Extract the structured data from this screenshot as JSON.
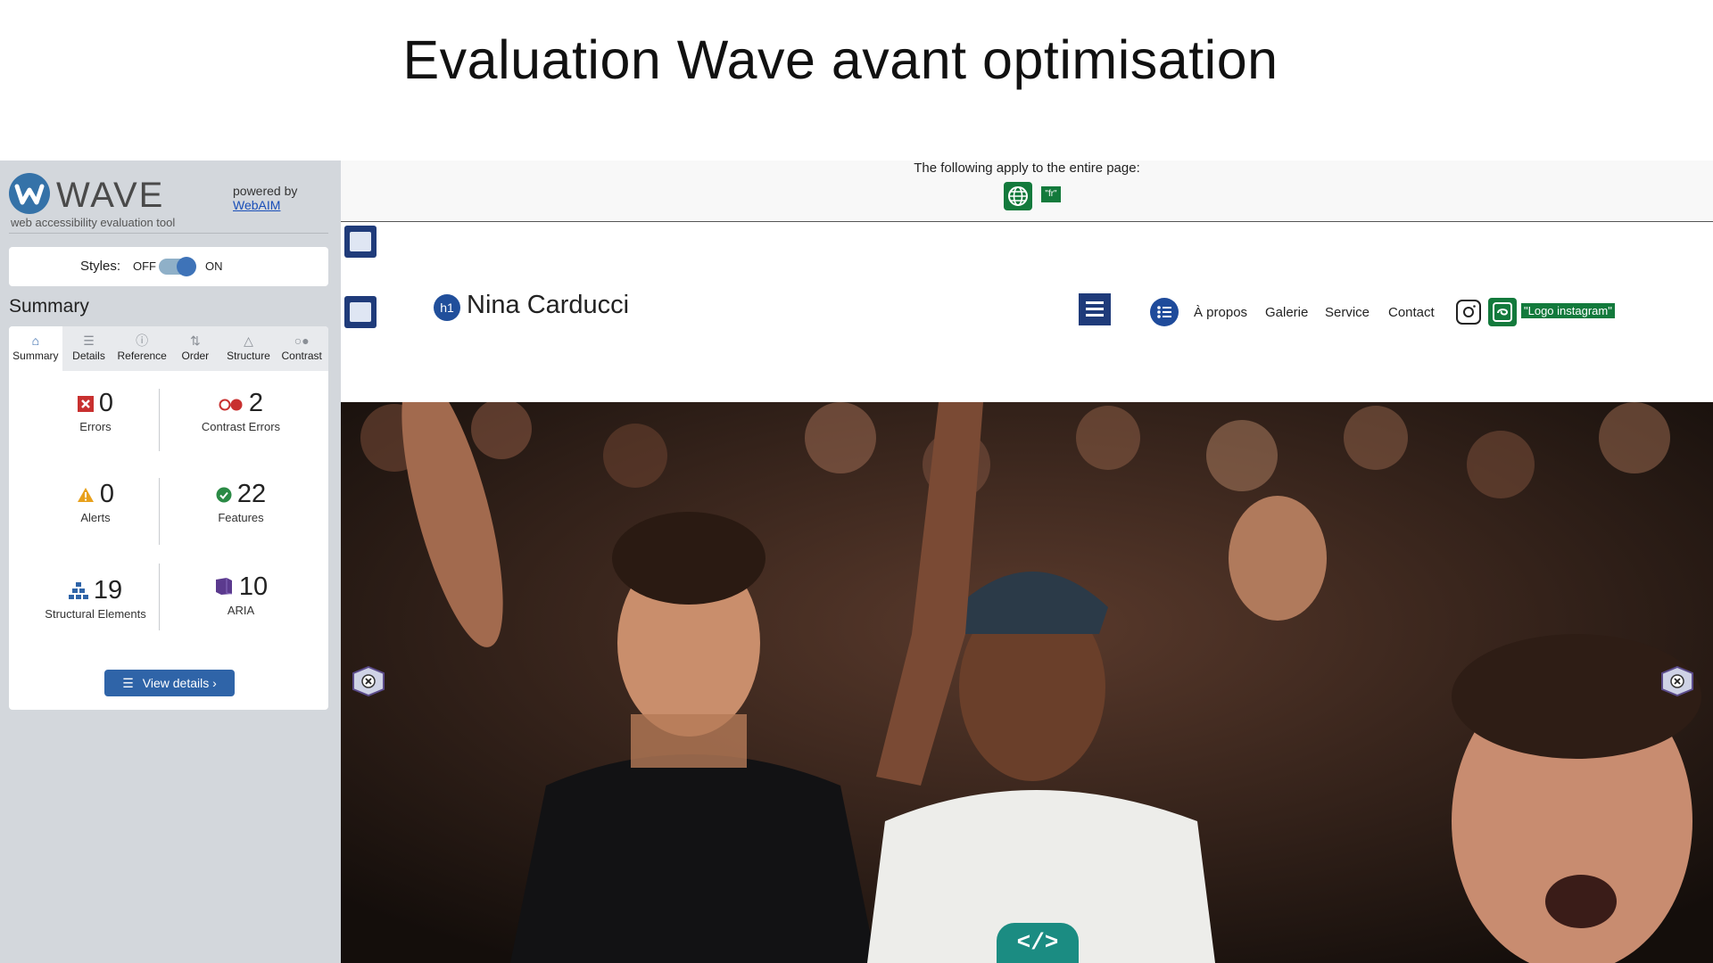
{
  "slide": {
    "title": "Evaluation Wave avant optimisation"
  },
  "wave": {
    "logo_text": "WAVE",
    "subtitle": "web accessibility evaluation tool",
    "powered_by": "powered by",
    "powered_link": "WebAIM",
    "styles": {
      "label": "Styles:",
      "off": "OFF",
      "on": "ON",
      "enabled": true
    },
    "summary_title": "Summary",
    "tabs": [
      {
        "label": "Summary",
        "icon": "home-icon",
        "active": true
      },
      {
        "label": "Details",
        "icon": "list-icon"
      },
      {
        "label": "Reference",
        "icon": "info-icon"
      },
      {
        "label": "Order",
        "icon": "order-icon"
      },
      {
        "label": "Structure",
        "icon": "structure-icon"
      },
      {
        "label": "Contrast",
        "icon": "contrast-icon"
      }
    ],
    "stats": {
      "errors": {
        "value": "0",
        "label": "Errors",
        "color": "#c8302f"
      },
      "contrast": {
        "value": "2",
        "label": "Contrast Errors",
        "color": "#c8302f"
      },
      "alerts": {
        "value": "0",
        "label": "Alerts",
        "color": "#e8a11c"
      },
      "features": {
        "value": "22",
        "label": "Features",
        "color": "#2a8a45"
      },
      "structural": {
        "value": "19",
        "label": "Structural Elements",
        "color": "#2f64a8"
      },
      "aria": {
        "value": "10",
        "label": "ARIA",
        "color": "#5b3a8e"
      }
    },
    "view_details": "View details ›"
  },
  "page": {
    "notice": "The following apply to the entire page:",
    "lang_tag": "\"fr\"",
    "h1_badge": "h1",
    "site_name": "Nina Carducci",
    "nav": [
      "À propos",
      "Galerie",
      "Service",
      "Contact"
    ],
    "alt_tag": "\"Logo instagram\"",
    "code_tab": "</>"
  }
}
